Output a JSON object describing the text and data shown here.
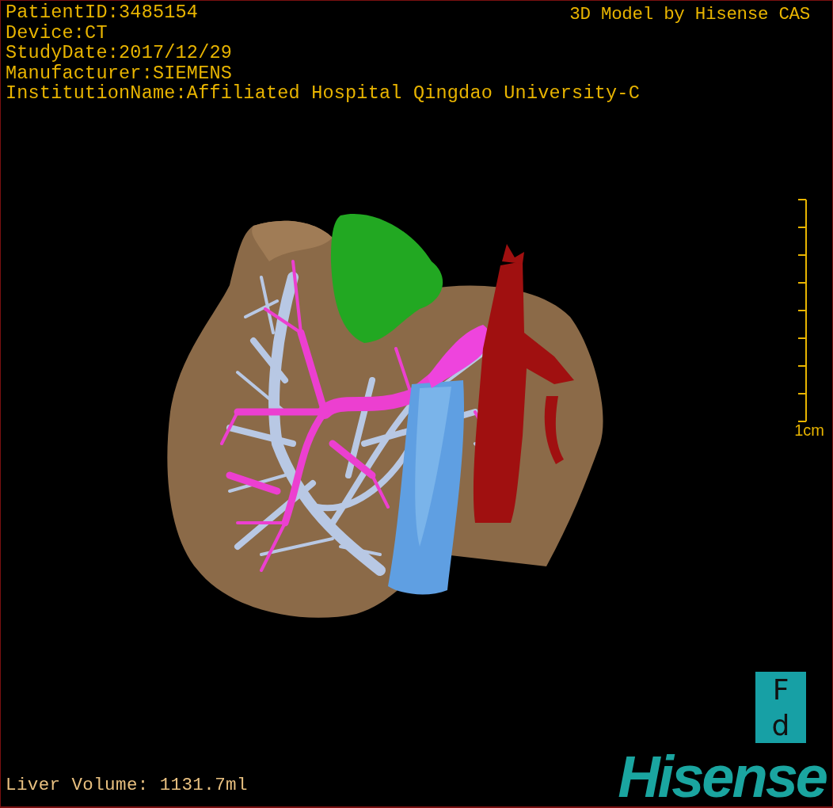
{
  "study_info": [
    "PatientID:3485154",
    "Device:CT",
    "StudyDate:2017/12/29",
    "Manufacturer:SIEMENS",
    "InstitutionName:Affiliated Hospital Qingdao University-C"
  ],
  "title": "3D Model by Hisense CAS",
  "scale_bar": {
    "label": "1cm"
  },
  "liver_volume": "Liver Volume: 1131.7ml",
  "orientation_marker": {
    "top": "F",
    "bottom": "d"
  },
  "logo": "Hisense"
}
